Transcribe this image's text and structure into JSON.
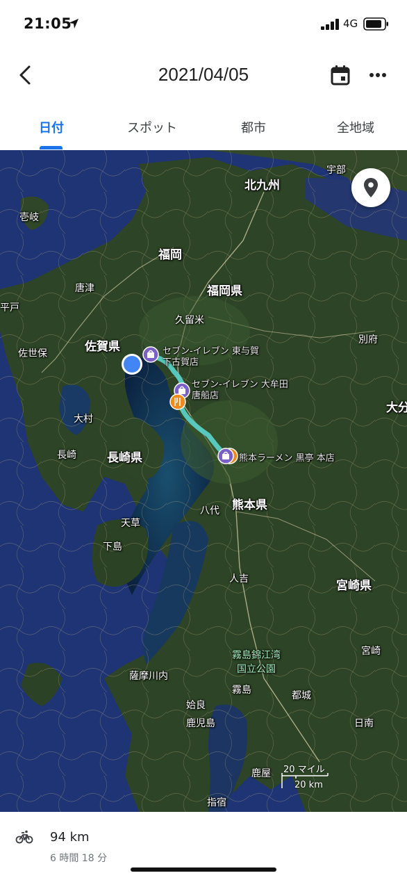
{
  "status_bar": {
    "time": "21:05",
    "network": "4G"
  },
  "header": {
    "title": "2021/04/05"
  },
  "tabs": [
    {
      "label": "日付",
      "active": true
    },
    {
      "label": "スポット",
      "active": false
    },
    {
      "label": "都市",
      "active": false
    },
    {
      "label": "全地域",
      "active": false
    }
  ],
  "map": {
    "labels": {
      "kitakyushu": "北九州",
      "ube": "宇部",
      "iki": "壱岐",
      "fukuoka": "福岡",
      "fukuoka_pref": "福岡県",
      "karatsu": "唐津",
      "hirado": "平戸",
      "kurume": "久留米",
      "saga_pref": "佐賀県",
      "sasebo": "佐世保",
      "beppu": "別府",
      "oita": "大分",
      "omura": "大村",
      "nagasaki": "長崎",
      "nagasaki_pref": "長崎県",
      "kumamoto_pref": "熊本県",
      "yatsushiro": "八代",
      "amakusa": "天草",
      "shimoshima": "下島",
      "hitoyoshi": "人吉",
      "miyazaki_pref": "宮崎県",
      "kirishima_park": "霧島錦江湾\n国立公園",
      "satsumasendai": "薩摩川内",
      "kirishima": "霧島",
      "miyakonojo": "都城",
      "miyazaki": "宮崎",
      "aira": "姶良",
      "kagoshima": "鹿児島",
      "nichinan": "日南",
      "kanoya": "鹿屋",
      "ibusuki": "指宿"
    },
    "pois": [
      {
        "name": "セブン-イレブン 東与賀\n下古賀店",
        "type": "shop"
      },
      {
        "name": "セブン-イレブン 大牟田\n唐船店",
        "type": "shop"
      },
      {
        "name": "熊本ラーメン 黒亭 本店",
        "type": "restaurant"
      }
    ],
    "scale": {
      "imperial": "20 マイル",
      "metric": "20 km"
    },
    "route_color": "#5ad2c8"
  },
  "summary": {
    "activity_icon": "bicycle-icon",
    "distance": "94 km",
    "duration": "6 時間 18 分"
  }
}
